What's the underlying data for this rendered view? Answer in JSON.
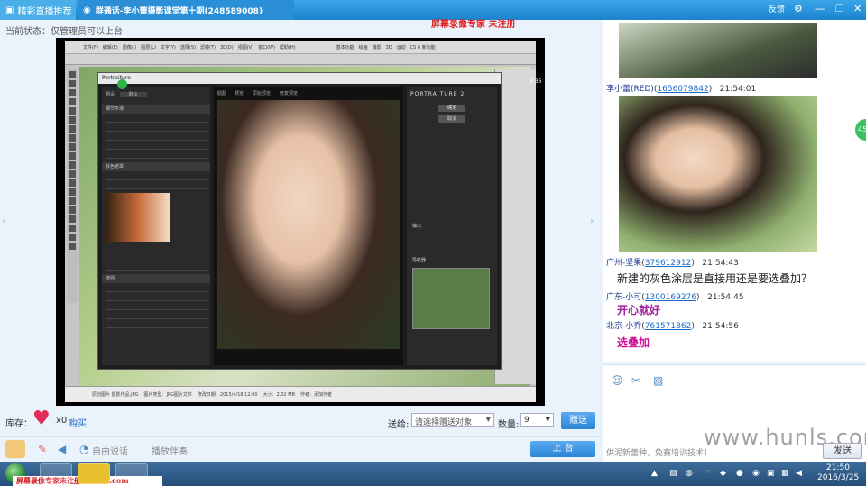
{
  "window": {
    "tab_live": "精彩直播推荐",
    "tab_room": "群通话-李小蕾摄影课堂第十期(248589008)",
    "watermark_recorder": "屏幕录像专家 未注册",
    "feedback_label": "反馈",
    "controls": [
      "⚙",
      "—",
      "❐",
      "✕"
    ]
  },
  "status": {
    "text": "当前状态：仅管理员可以上台"
  },
  "video": {
    "counter": "4:36",
    "photoshop": {
      "menubar_items": [
        "文件(F)",
        "编辑(E)",
        "图像(I)",
        "图层(L)",
        "文字(Y)",
        "选择(S)",
        "滤镜(T)",
        "3D(D)",
        "视图(V)",
        "窗口(W)",
        "帮助(H)"
      ],
      "workspace_tabs": [
        "基本功能",
        "绘画",
        "摄影",
        "3D",
        "运动",
        "CS 6 新功能"
      ],
      "filename": "原创图片 摄影作品.JPG",
      "bottom_fields": [
        "图片类型：JPG图片文件",
        "修改日期：2015/4/18 12:00",
        "大小：2.02 MB",
        "作者：添加作者"
      ]
    },
    "portraiture": {
      "title": "Portraiture",
      "left_sections": [
        "细节平滑",
        "肤色遮罩",
        "增强"
      ],
      "preset_label": "预设",
      "preset_value": "默认",
      "right_brand": "PORTRAITURE 2",
      "right_buttons": [
        "确定",
        "取消"
      ],
      "output_label": "输出",
      "nav_label": "导航器",
      "view_tabs": [
        "视图",
        "预览",
        "原始预览",
        "修复预览"
      ]
    }
  },
  "gift": {
    "inventory_label": "库存：",
    "count": "x0",
    "buy_link": "购买",
    "send_to_label": "送给:",
    "send_to_placeholder": "请选择赠送对象",
    "quantity_label": "数量:",
    "quantity_value": "9",
    "give_button": "赠送"
  },
  "toolbar": {
    "free_talk": "自由说话",
    "play_music": "播放伴奏",
    "stage_button": "上 台"
  },
  "chat": {
    "messages": [
      {
        "user": "李小蕾(RED)",
        "id": "1656079842",
        "time": "21:54:01",
        "kind": "image"
      },
      {
        "user": "广州-坚果",
        "id": "379612912",
        "time": "21:54:43",
        "text": "新建的灰色涂层是直接用还是要选叠加？",
        "color": "#222222"
      },
      {
        "user": "广东-小可",
        "id": "1300169276",
        "time": "21:54:45",
        "text": "开心就好",
        "color": "#a020a0"
      },
      {
        "user": "北京-小乔",
        "id": "761571862",
        "time": "21:54:56",
        "text": "选叠加",
        "color": "#d0109a"
      }
    ],
    "online_badge": "45",
    "input_placeholder": "供泥新蕾种，免赛培训技术！",
    "send_button": "发送",
    "site_watermark": "www.hunls.com"
  },
  "taskbar": {
    "recorder_watermark": "屏幕录像专家未注册 tlxsoft.com",
    "time": "21:50",
    "date": "2016/3/25"
  },
  "colors": {
    "titlebar": "#1c83cf",
    "accent": "#2a84d6",
    "taskbar": "#254d78"
  }
}
